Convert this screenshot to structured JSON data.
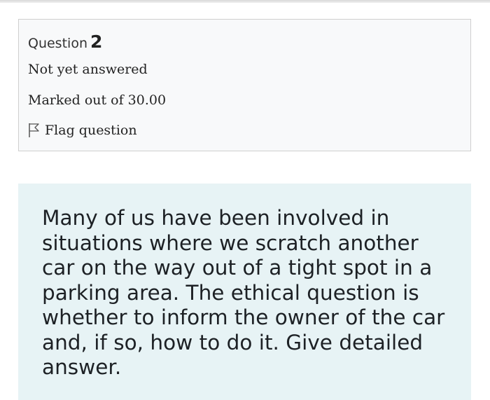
{
  "question": {
    "label": "Question",
    "number": "2",
    "status": "Not yet answered",
    "grade": "Marked out of 30.00",
    "flag_label": "Flag question",
    "flag_icon": "flag-icon",
    "text": "Many of us have been involved in situations where we scratch another car on the way out of a tight spot in a parking area. The ethical question is whether to inform the owner of the car and, if so, how to do it. Give detailed answer."
  },
  "colors": {
    "info_background": "#f8f9fa",
    "info_border": "#cfcfcf",
    "question_background": "#e7f3f5",
    "text": "#1d2125"
  }
}
